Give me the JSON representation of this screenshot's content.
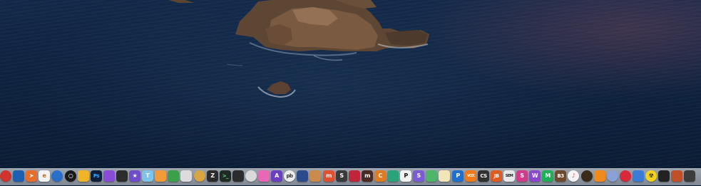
{
  "desktop": {
    "wallpaper": "coastal rock island in dark ocean"
  },
  "dock": {
    "background": "#8c949e",
    "icons": [
      {
        "name": "red-dot-icon",
        "label": "",
        "bg": "#d0342c",
        "fg": "#ffffff",
        "shape": "round",
        "running": false
      },
      {
        "name": "blue-square-app-icon",
        "label": "",
        "bg": "#1d5fb0",
        "fg": "#ffffff",
        "shape": "square",
        "running": false
      },
      {
        "name": "paper-plane-icon",
        "label": "➤",
        "bg": "#e86c2a",
        "fg": "#ffffff",
        "shape": "square",
        "running": false
      },
      {
        "name": "e-app-icon",
        "label": "e",
        "bg": "#f2f2f2",
        "fg": "#c46a1d",
        "shape": "square",
        "running": false
      },
      {
        "name": "finder-round-icon",
        "label": "",
        "bg": "#2a6fc7",
        "fg": "#ffffff",
        "shape": "round",
        "running": false
      },
      {
        "name": "black-circle-icon",
        "label": "○",
        "bg": "#1a1a1a",
        "fg": "#ffffff",
        "shape": "round",
        "running": false
      },
      {
        "name": "photos-color-icon",
        "label": "",
        "bg": "#f0b429",
        "fg": "#ffffff",
        "shape": "square",
        "running": false
      },
      {
        "name": "photoshop-icon",
        "label": "Ps",
        "bg": "#0b1f3a",
        "fg": "#31a8ff",
        "shape": "square",
        "running": false
      },
      {
        "name": "gradient-app-icon",
        "label": "",
        "bg": "#8a4bd8",
        "fg": "#ffffff",
        "shape": "square",
        "running": false
      },
      {
        "name": "film-clapper-icon",
        "label": "",
        "bg": "#2c2c2c",
        "fg": "#ffffff",
        "shape": "square",
        "running": false
      },
      {
        "name": "star-icon",
        "label": "★",
        "bg": "#6f4cc9",
        "fg": "#ffffff",
        "shape": "square",
        "running": false
      },
      {
        "name": "pen-tool-icon",
        "label": "T",
        "bg": "#7fc4e8",
        "fg": "#ffffff",
        "shape": "square",
        "running": false
      },
      {
        "name": "pages-icon",
        "label": "",
        "bg": "#f29b38",
        "fg": "#ffffff",
        "shape": "square",
        "running": false
      },
      {
        "name": "bar-chart-icon",
        "label": "",
        "bg": "#3aa04a",
        "fg": "#ffffff",
        "shape": "square",
        "running": false
      },
      {
        "name": "cube-icon",
        "label": "",
        "bg": "#dcdcdc",
        "fg": "#555555",
        "shape": "square",
        "running": false
      },
      {
        "name": "coin-icon",
        "label": "",
        "bg": "#d9a441",
        "fg": "#ffffff",
        "shape": "round",
        "running": false
      },
      {
        "name": "z-app-icon",
        "label": "Z",
        "bg": "#2b2b2b",
        "fg": "#ffffff",
        "shape": "square",
        "running": false
      },
      {
        "name": "terminal-icon",
        "label": ">_",
        "bg": "#1f2a24",
        "fg": "#6fe08a",
        "shape": "square",
        "running": false
      },
      {
        "name": "piano-keys-icon",
        "label": "",
        "bg": "#2c2c2c",
        "fg": "#ffffff",
        "shape": "square",
        "running": false
      },
      {
        "name": "gauge-icon",
        "label": "",
        "bg": "#d9d9d9",
        "fg": "#333333",
        "shape": "round",
        "running": false
      },
      {
        "name": "pink-folder-icon",
        "label": "",
        "bg": "#e868b5",
        "fg": "#ffffff",
        "shape": "square",
        "running": false
      },
      {
        "name": "a-triangle-icon",
        "label": "A",
        "bg": "#6a3fc1",
        "fg": "#ffffff",
        "shape": "square",
        "running": false
      },
      {
        "name": "pb-app-icon",
        "label": "pb",
        "bg": "#ececec",
        "fg": "#333333",
        "shape": "round",
        "running": false
      },
      {
        "name": "screen-app-icon",
        "label": "",
        "bg": "#2b4a8c",
        "fg": "#ffffff",
        "shape": "square",
        "running": false
      },
      {
        "name": "books-shelf-icon",
        "label": "",
        "bg": "#c98a4b",
        "fg": "#ffffff",
        "shape": "square",
        "running": false
      },
      {
        "name": "mm-app-icon",
        "label": "m",
        "bg": "#e0502e",
        "fg": "#ffffff",
        "shape": "square",
        "running": false
      },
      {
        "name": "s-dark-icon",
        "label": "S",
        "bg": "#3a3a3a",
        "fg": "#ffffff",
        "shape": "square",
        "running": false
      },
      {
        "name": "red-swirl-icon",
        "label": "",
        "bg": "#c0263a",
        "fg": "#ffffff",
        "shape": "square",
        "running": false
      },
      {
        "name": "m-dark-icon",
        "label": "m",
        "bg": "#4a2a22",
        "fg": "#ffffff",
        "shape": "square",
        "running": false
      },
      {
        "name": "c-orange-icon",
        "label": "C",
        "bg": "#e07b22",
        "fg": "#ffffff",
        "shape": "square",
        "running": false
      },
      {
        "name": "ox-app-icon",
        "label": "",
        "bg": "#2aa37a",
        "fg": "#ffffff",
        "shape": "square",
        "running": false
      },
      {
        "name": "p-white-icon",
        "label": "P",
        "bg": "#f2f2f2",
        "fg": "#111111",
        "shape": "square",
        "running": false
      },
      {
        "name": "s-purple-icon",
        "label": "S",
        "bg": "#7a5cd6",
        "fg": "#ffffff",
        "shape": "square",
        "running": false
      },
      {
        "name": "green-leaf-icon",
        "label": "",
        "bg": "#4fb56a",
        "fg": "#ffffff",
        "shape": "square",
        "running": false
      },
      {
        "name": "notepad-icon",
        "label": "",
        "bg": "#f2e6b8",
        "fg": "#555555",
        "shape": "square",
        "running": false
      },
      {
        "name": "blue-p-icon",
        "label": "P",
        "bg": "#1f6fd1",
        "fg": "#ffffff",
        "shape": "square",
        "running": false
      },
      {
        "name": "vox-icon",
        "label": "VOX",
        "bg": "#f07a1a",
        "fg": "#ffffff",
        "shape": "square",
        "running": false
      },
      {
        "name": "cs-icon",
        "label": "CS",
        "bg": "#303030",
        "fg": "#ffffff",
        "shape": "square",
        "running": false
      },
      {
        "name": "jb-icon",
        "label": "JB",
        "bg": "#e05a20",
        "fg": "#ffffff",
        "shape": "square",
        "running": false
      },
      {
        "name": "sem-icon",
        "label": "SEM",
        "bg": "#e8e8e8",
        "fg": "#222222",
        "shape": "square",
        "running": false
      },
      {
        "name": "pink-s-icon",
        "label": "S",
        "bg": "#d23a8a",
        "fg": "#ffffff",
        "shape": "square",
        "running": false
      },
      {
        "name": "w-purple-icon",
        "label": "W",
        "bg": "#8a47c9",
        "fg": "#ffffff",
        "shape": "square",
        "running": false
      },
      {
        "name": "green-m-icon",
        "label": "M",
        "bg": "#1fae5a",
        "fg": "#ffffff",
        "shape": "square",
        "running": false
      },
      {
        "name": "b3-icon",
        "label": "B3",
        "bg": "#6b4a2e",
        "fg": "#ffffff",
        "shape": "square",
        "running": false
      },
      {
        "name": "music-note-icon",
        "label": "♪",
        "bg": "#f4f4f4",
        "fg": "#f0445a",
        "shape": "round",
        "running": false
      },
      {
        "name": "speaker-icon",
        "label": "",
        "bg": "#3a2a1a",
        "fg": "#e0a030",
        "shape": "round",
        "running": false
      },
      {
        "name": "vlc-cone-icon",
        "label": "",
        "bg": "#f08a1c",
        "fg": "#ffffff",
        "shape": "square",
        "running": false
      },
      {
        "name": "alien-ship-icon",
        "label": "",
        "bg": "#8aa0d8",
        "fg": "#ffffff",
        "shape": "round",
        "running": false
      },
      {
        "name": "red-target-icon",
        "label": "",
        "bg": "#d8283a",
        "fg": "#ffffff",
        "shape": "round",
        "running": false
      },
      {
        "name": "audio-wave-icon",
        "label": "",
        "bg": "#3a7bd5",
        "fg": "#ffffff",
        "shape": "square",
        "running": false
      },
      {
        "name": "radiation-icon",
        "label": "☢",
        "bg": "#f2d21c",
        "fg": "#111111",
        "shape": "round",
        "running": false
      },
      {
        "name": "pulse-icon",
        "label": "",
        "bg": "#222222",
        "fg": "#e04040",
        "shape": "square",
        "running": false
      },
      {
        "name": "fan-icon",
        "label": "",
        "bg": "#c0502a",
        "fg": "#ffffff",
        "shape": "square",
        "running": false
      },
      {
        "name": "shield-app-icon",
        "label": "",
        "bg": "#3c3c3c",
        "fg": "#ffffff",
        "shape": "square",
        "running": false
      }
    ]
  }
}
